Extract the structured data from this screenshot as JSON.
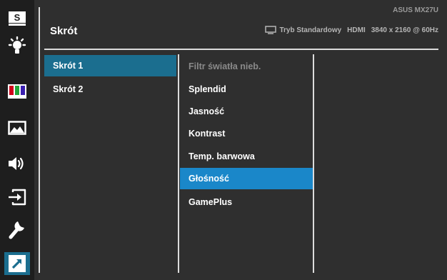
{
  "header": {
    "brand": "ASUS MX27U",
    "title": "Skrót",
    "status": {
      "mode": "Tryb Standardowy",
      "input": "HDMI",
      "resolution": "3840 x 2160 @ 60Hz"
    }
  },
  "rail": {
    "items": [
      {
        "icon": "splendid-s-icon",
        "label": "S"
      },
      {
        "icon": "blue-light-filter-icon"
      },
      {
        "icon": "color-icon"
      },
      {
        "icon": "image-icon"
      },
      {
        "icon": "sound-icon"
      },
      {
        "icon": "input-select-icon"
      },
      {
        "icon": "system-setup-icon"
      },
      {
        "icon": "shortcut-icon",
        "active": true
      }
    ]
  },
  "shortcuts": {
    "items": [
      {
        "label": "Skrót 1",
        "selected": true
      },
      {
        "label": "Skrót 2",
        "selected": false
      }
    ]
  },
  "options": {
    "items": [
      {
        "label": "Filtr światła nieb.",
        "state": "disabled"
      },
      {
        "label": "Splendid",
        "state": "normal"
      },
      {
        "label": "Jasność",
        "state": "normal"
      },
      {
        "label": "Kontrast",
        "state": "normal"
      },
      {
        "label": "Temp. barwowa",
        "state": "normal"
      },
      {
        "label": "Głośność",
        "state": "highlighted"
      },
      {
        "label": "GamePlus",
        "state": "normal"
      }
    ]
  },
  "colors": {
    "background": "#2f2f2f",
    "rail": "#1e1e1e",
    "selected": "#1b6e8f",
    "highlight": "#1a87c9"
  }
}
